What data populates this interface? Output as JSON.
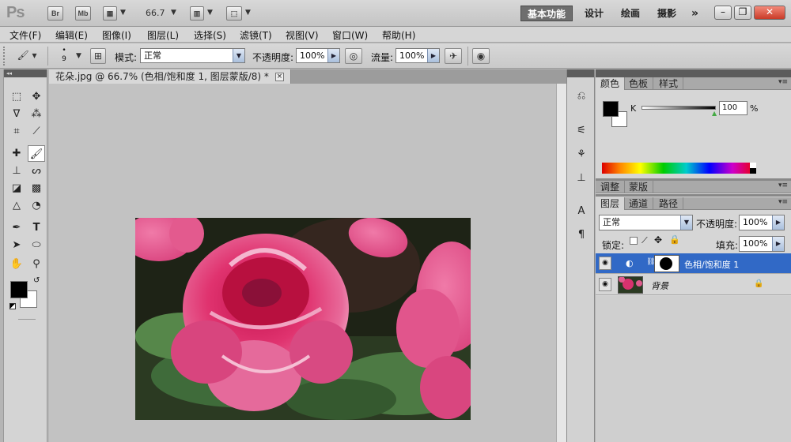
{
  "app": {
    "logo": "Ps",
    "bridge_label": "Br",
    "minibridge_label": "Mb",
    "zoom_value": "66.7",
    "workspaces": [
      "基本功能",
      "设计",
      "绘画",
      "摄影"
    ],
    "workspace_more": "»"
  },
  "menu": [
    "文件(F)",
    "编辑(E)",
    "图像(I)",
    "图层(L)",
    "选择(S)",
    "滤镜(T)",
    "视图(V)",
    "窗口(W)",
    "帮助(H)"
  ],
  "options": {
    "brush_size": "9",
    "mode_label": "模式:",
    "mode_value": "正常",
    "opacity_label": "不透明度:",
    "opacity_value": "100%",
    "flow_label": "流量:",
    "flow_value": "100%"
  },
  "document": {
    "tab_title": "花朵.jpg @ 66.7% (色相/饱和度 1, 图层蒙版/8) *",
    "close_glyph": "×"
  },
  "color_panel": {
    "tabs": [
      "颜色",
      "色板",
      "样式"
    ],
    "channel_label": "K",
    "channel_value": "100",
    "percent": "%"
  },
  "adjust_panel": {
    "tabs": [
      "调整",
      "蒙版"
    ]
  },
  "layers_panel": {
    "tabs": [
      "图层",
      "通道",
      "路径"
    ],
    "blend_mode": "正常",
    "opacity_label": "不透明度:",
    "opacity_value": "100%",
    "lock_label": "锁定:",
    "fill_label": "填充:",
    "fill_value": "100%",
    "layers": [
      {
        "name": "色相/饱和度 1",
        "selected": true
      },
      {
        "name": "背景",
        "selected": false
      }
    ]
  },
  "colors": {
    "selection_blue": "#3169c6",
    "app_bg": "#b5b5b5"
  }
}
